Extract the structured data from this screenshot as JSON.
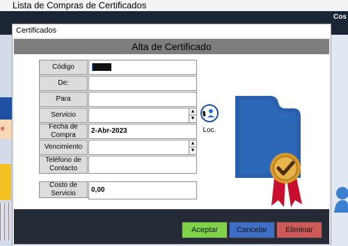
{
  "background": {
    "window_title": "Lista de Compras de Certificados",
    "header_right_text": "Cos Servi",
    "left_badge": "e"
  },
  "dialog": {
    "title": "Certificados",
    "header": "Alta de Certificado",
    "fields": {
      "codigo": {
        "label": "Código",
        "value": ""
      },
      "de": {
        "label": "De:",
        "value": ""
      },
      "para": {
        "label": "Para",
        "value": ""
      },
      "servicio": {
        "label": "Servicio",
        "value": ""
      },
      "fecha_compra": {
        "label": "Fecha de Compra",
        "value": "2-Abr-2023"
      },
      "vencimiento": {
        "label": "Vencimiento",
        "value": ""
      },
      "telefono": {
        "label": "Teléfono de Contacto",
        "value": ""
      },
      "costo": {
        "label": "Costo de Servicio",
        "value": "0,00"
      }
    },
    "locate": {
      "label": "Loc.",
      "icon": "phone-contact-icon"
    },
    "certificate_image": "certificate-award-icon",
    "buttons": {
      "accept": "Aceptar",
      "cancel": "Cancelar",
      "delete": "Eliminar"
    },
    "colors": {
      "header_bg": "#7e7e7e",
      "footer_bg": "#242a36",
      "accept": "#7fd24a",
      "cancel": "#3e6fc4",
      "delete": "#cc5a58"
    }
  }
}
